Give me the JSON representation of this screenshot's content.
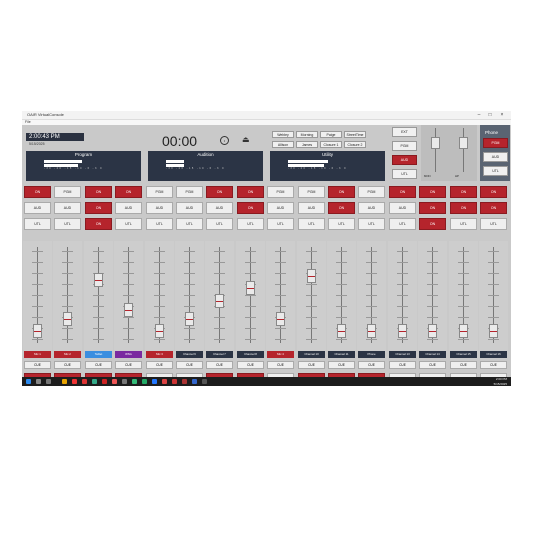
{
  "window": {
    "title": "OAIR VirtualConsole",
    "menu": "File"
  },
  "clock": {
    "time": "2:00:43 PM",
    "date": "5/15/2025"
  },
  "meters": [
    {
      "title": "Program",
      "scale": "-30 -20 -15 -10 -6 -3 0"
    },
    {
      "title": "Audition",
      "scale": "-30 -20 -15 -10 -6 -3 0"
    },
    {
      "title": "Utility",
      "scale": "-30 -20 -15 -10 -6 -3 0"
    }
  ],
  "timer": {
    "value": "00:00",
    "button": "•",
    "eject": "⏏"
  },
  "hotkeys": [
    "Webley",
    "Morning",
    "Paige",
    "StreetTime",
    "Allison",
    "James",
    "Closure 1",
    "Closure 2"
  ],
  "monitor": {
    "buttons": [
      "EXT",
      "PGM",
      "AUD",
      "UTL"
    ],
    "knob_labels": [
      "MON",
      "HP"
    ]
  },
  "phone": {
    "title": "Phone",
    "buttons": [
      "PGM",
      "AUD",
      "UTL"
    ]
  },
  "channels": [
    {
      "label": "Mic 1",
      "label_color": "red",
      "pgm": "ON",
      "aud": "AUD",
      "utl": "UTL",
      "cue": "CUE",
      "on": "ON",
      "on_active": true,
      "pgm_red": true,
      "aud_red": false,
      "utl_red": false,
      "fader": 0.1
    },
    {
      "label": "Mic 2",
      "label_color": "red",
      "pgm": "PGM",
      "aud": "AUD",
      "utl": "UTL",
      "cue": "CUE",
      "on": "ON",
      "on_active": true,
      "pgm_red": false,
      "aud_red": false,
      "utl_red": false,
      "fader": 0.25
    },
    {
      "label": "Tablet",
      "label_color": "blue",
      "pgm": "ON",
      "aud": "ON",
      "utl": "ON",
      "cue": "CUE",
      "on": "ON",
      "on_active": true,
      "pgm_red": true,
      "aud_red": true,
      "utl_red": true,
      "fader": 0.7
    },
    {
      "label": "WSG",
      "label_color": "purple",
      "pgm": "ON",
      "aud": "AUD",
      "utl": "UTL",
      "cue": "CUE",
      "on": "ON",
      "on_active": true,
      "pgm_red": true,
      "aud_red": false,
      "utl_red": false,
      "fader": 0.35
    },
    {
      "label": "Mic 3",
      "label_color": "red",
      "pgm": "PGM",
      "aud": "AUD",
      "utl": "UTL",
      "cue": "CUE",
      "on": "OFF",
      "on_active": false,
      "pgm_red": false,
      "aud_red": false,
      "utl_red": false,
      "fader": 0.1
    },
    {
      "label": "Channel 6",
      "label_color": "dark",
      "pgm": "PGM",
      "aud": "AUD",
      "utl": "UTL",
      "cue": "CUE",
      "on": "OFF",
      "on_active": false,
      "pgm_red": false,
      "aud_red": false,
      "utl_red": false,
      "fader": 0.25
    },
    {
      "label": "Channel 7",
      "label_color": "dark",
      "pgm": "ON",
      "aud": "AUD",
      "utl": "UTL",
      "cue": "CUE",
      "on": "ON",
      "on_active": true,
      "pgm_red": true,
      "aud_red": false,
      "utl_red": false,
      "fader": 0.45
    },
    {
      "label": "Channel 8",
      "label_color": "dark",
      "pgm": "ON",
      "aud": "ON",
      "utl": "UTL",
      "cue": "CUE",
      "on": "ON",
      "on_active": true,
      "pgm_red": true,
      "aud_red": true,
      "utl_red": false,
      "fader": 0.6
    },
    {
      "label": "Mic 4",
      "label_color": "red",
      "pgm": "PGM",
      "aud": "AUD",
      "utl": "UTL",
      "cue": "CUE",
      "on": "OFF",
      "on_active": false,
      "pgm_red": false,
      "aud_red": false,
      "utl_red": false,
      "fader": 0.25
    },
    {
      "label": "Channel 10",
      "label_color": "dark",
      "pgm": "PGM",
      "aud": "AUD",
      "utl": "UTL",
      "cue": "CUE",
      "on": "ON",
      "on_active": true,
      "pgm_red": false,
      "aud_red": false,
      "utl_red": false,
      "fader": 0.75
    },
    {
      "label": "Channel 11",
      "label_color": "dark",
      "pgm": "ON",
      "aud": "ON",
      "utl": "UTL",
      "cue": "CUE",
      "on": "ON",
      "on_active": true,
      "pgm_red": true,
      "aud_red": true,
      "utl_red": false,
      "fader": 0.1
    },
    {
      "label": "Phone",
      "label_color": "dark",
      "pgm": "PGM",
      "aud": "AUD",
      "utl": "UTL",
      "cue": "CUE",
      "on": "ON",
      "on_active": true,
      "pgm_red": false,
      "aud_red": false,
      "utl_red": false,
      "fader": 0.1
    },
    {
      "label": "Channel 13",
      "label_color": "dark",
      "pgm": "ON",
      "aud": "AUD",
      "utl": "UTL",
      "cue": "CUE",
      "on": "OFF",
      "on_active": false,
      "pgm_red": true,
      "aud_red": false,
      "utl_red": false,
      "fader": 0.1
    },
    {
      "label": "Channel 14",
      "label_color": "dark",
      "pgm": "ON",
      "aud": "ON",
      "utl": "ON",
      "cue": "CUE",
      "on": "OFF",
      "on_active": false,
      "pgm_red": true,
      "aud_red": true,
      "utl_red": true,
      "fader": 0.1
    },
    {
      "label": "Channel 15",
      "label_color": "dark",
      "pgm": "ON",
      "aud": "ON",
      "utl": "UTL",
      "cue": "CUE",
      "on": "OFF",
      "on_active": false,
      "pgm_red": true,
      "aud_red": true,
      "utl_red": false,
      "fader": 0.1
    },
    {
      "label": "Channel 16",
      "label_color": "dark",
      "pgm": "ON",
      "aud": "ON",
      "utl": "UTL",
      "cue": "CUE",
      "on": "OFF",
      "on_active": false,
      "pgm_red": true,
      "aud_red": true,
      "utl_red": false,
      "fader": 0.1
    }
  ],
  "tray": {
    "time": "2:00 PM",
    "date": "5/15/2025"
  },
  "colors": {
    "accent_red": "#b5242c",
    "panel_dark": "#2b3445",
    "blue": "#3a8ee0",
    "purple": "#7a2aa0"
  }
}
